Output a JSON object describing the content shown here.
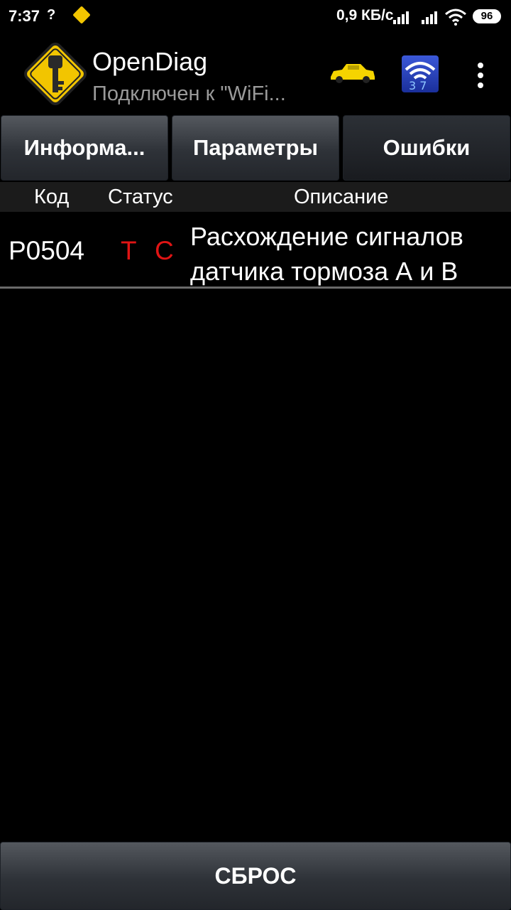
{
  "status_bar": {
    "time": "7:37",
    "question_mark": "?",
    "net_speed": "0,9 КБ/с",
    "battery": "96"
  },
  "app_bar": {
    "title": "OpenDiag",
    "subtitle": "Подключен к \"WiFi...",
    "logo_icon": "key-warning-sign-icon",
    "car_icon": "car-icon",
    "wifi_badge_icon": "wifi-adapter-icon",
    "menu_icon": "more-vert-icon"
  },
  "tabs": [
    {
      "label": "Информа..."
    },
    {
      "label": "Параметры"
    },
    {
      "label": "Ошибки",
      "active": true
    }
  ],
  "table": {
    "headers": {
      "code": "Код",
      "status": "Статус",
      "description": "Описание"
    },
    "rows": [
      {
        "code": "P0504",
        "status": [
          "T",
          "C"
        ],
        "description_line1": "Расхождение сигналов",
        "description_line2": "датчика тормоза А и В"
      }
    ]
  },
  "reset_button": {
    "label": "СБРОС"
  },
  "colors": {
    "background": "#000000",
    "status_red": "#e01414",
    "logo_yellow": "#f2c500",
    "car_yellow": "#f5d400"
  }
}
